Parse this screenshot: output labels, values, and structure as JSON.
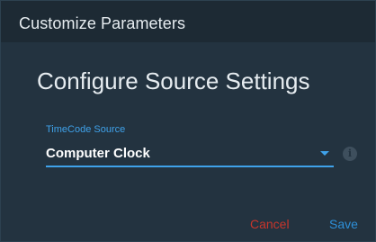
{
  "dialog": {
    "title": "Customize Parameters",
    "heading": "Configure Source Settings",
    "timecode": {
      "label": "TimeCode Source",
      "value": "Computer Clock",
      "info_icon": "i"
    },
    "actions": {
      "cancel_label": "Cancel",
      "save_label": "Save"
    }
  },
  "colors": {
    "background": "#233340",
    "title_bar": "#1d2a34",
    "accent": "#3fa2ea",
    "cancel": "#c8352b",
    "save": "#2d8fd8"
  }
}
